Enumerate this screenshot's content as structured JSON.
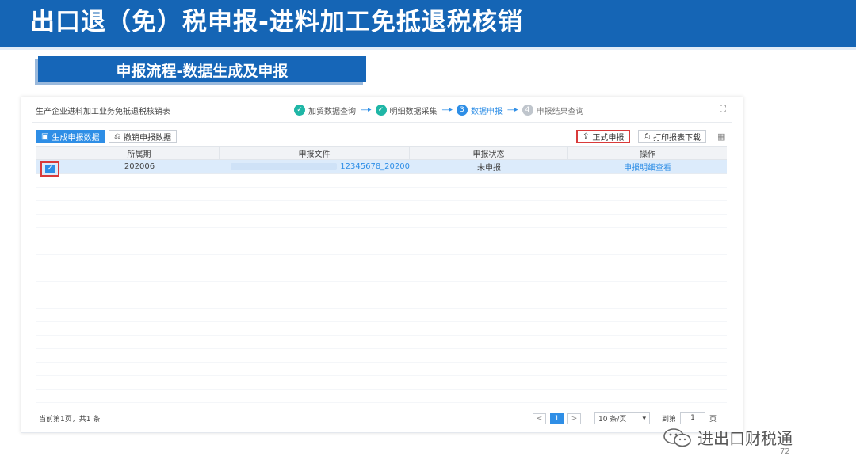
{
  "slide": {
    "title": "出口退（免）税申报-进料加工免抵退税核销",
    "section": "申报流程-数据生成及申报",
    "page_number": "72",
    "watermark": "进出口财税通"
  },
  "app": {
    "title": "生产企业进料加工业务免抵退税核销表",
    "steps": [
      {
        "num": "✓",
        "label": "加贸数据查询",
        "state": "done"
      },
      {
        "num": "✓",
        "label": "明细数据采集",
        "state": "done"
      },
      {
        "num": "3",
        "label": "数据申报",
        "state": "active"
      },
      {
        "num": "4",
        "label": "申报结果查询",
        "state": "todo"
      }
    ],
    "step_arrow": "----▸",
    "toolbar": {
      "generate_label": "生成申报数据",
      "revoke_label": "撤销申报数据",
      "submit_label": "正式申报",
      "print_label": "打印报表下载"
    },
    "table": {
      "headers": [
        "所属期",
        "申报文件",
        "申报状态",
        "操作"
      ],
      "rows": [
        {
          "period": "202006",
          "file": "12345678_20200",
          "status": "未申报",
          "action": "申报明细查看",
          "checked": true
        }
      ]
    },
    "footer": {
      "info": "当前第1页，共1 条",
      "prev": "<",
      "current_page": "1",
      "next": ">",
      "page_size": "10 条/页",
      "goto_label": "到第",
      "goto_value": "1",
      "page_unit": "页"
    }
  }
}
